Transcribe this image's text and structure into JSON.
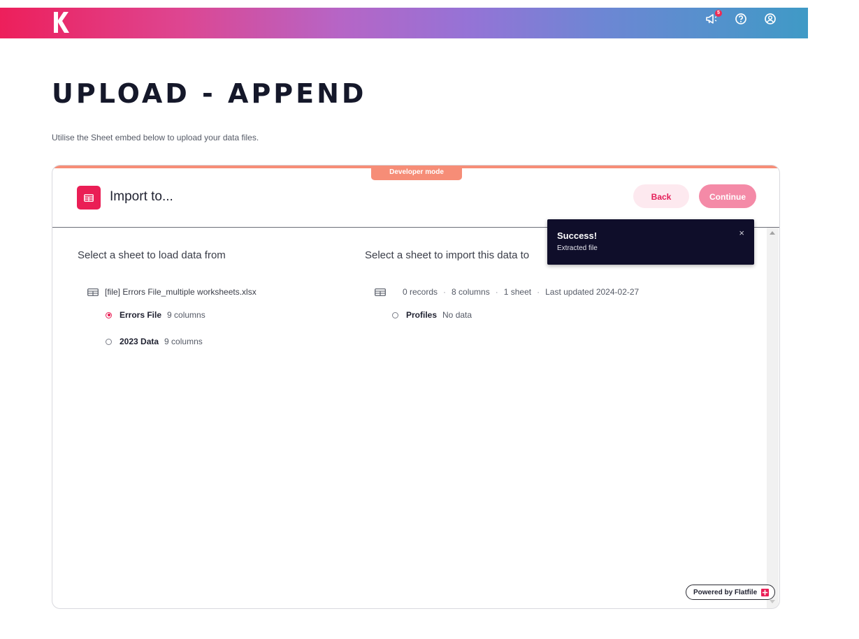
{
  "topbar": {
    "logo": "k-logo",
    "icons": [
      {
        "name": "megaphone-icon",
        "badge": "5"
      },
      {
        "name": "help-icon"
      },
      {
        "name": "account-icon"
      }
    ],
    "colors": {
      "start": "#ed1f5b",
      "end": "#3f9ac6"
    }
  },
  "page": {
    "title": "UPLOAD - APPEND",
    "subtitle": "Utilise the Sheet embed below to upload your data files."
  },
  "importer": {
    "developer_badge": "Developer mode",
    "header_title": "Import to...",
    "back_label": "Back",
    "continue_label": "Continue",
    "accent_color": "#ea1e55",
    "source": {
      "title": "Select a sheet to load data from",
      "file_name": "[file] Errors File_multiple worksheets.xlsx",
      "sheets": [
        {
          "name": "Errors File",
          "meta": "9 columns",
          "selected": true
        },
        {
          "name": "2023 Data",
          "meta": "9 columns",
          "selected": false
        }
      ]
    },
    "destination": {
      "title": "Select a sheet to import this data to",
      "records": "0 records",
      "columns": "8 columns",
      "sheet_count": "1 sheet",
      "last_updated": "Last updated 2024-02-27",
      "sheets": [
        {
          "name": "Profiles",
          "meta": "No data",
          "selected": false
        }
      ]
    },
    "powered_by": "Powered by Flatfile"
  },
  "toast": {
    "title": "Success!",
    "message": "Extracted file",
    "close": "×"
  }
}
